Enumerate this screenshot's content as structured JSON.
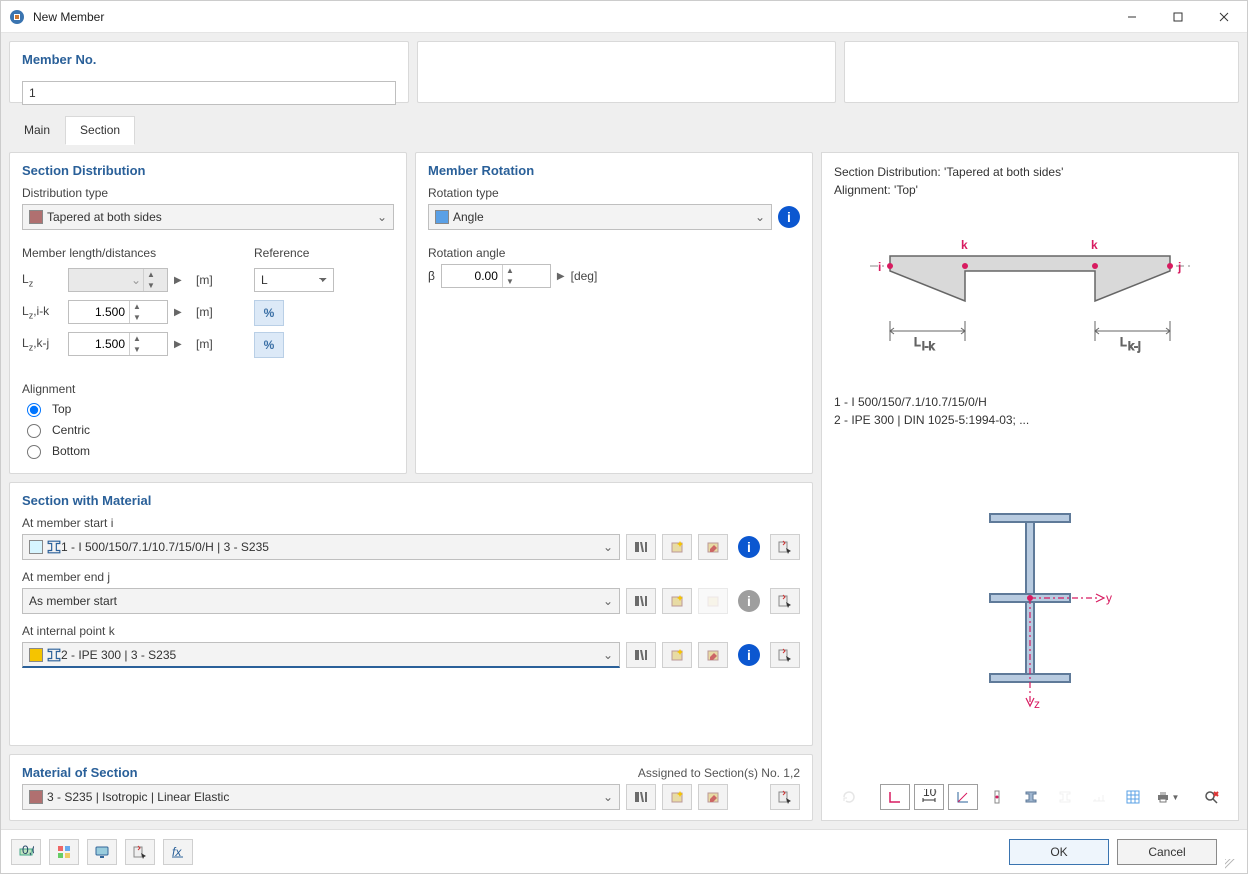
{
  "window": {
    "title": "New Member"
  },
  "header": {
    "member_no_label": "Member No.",
    "member_no_value": "1"
  },
  "tabs": {
    "main": "Main",
    "section": "Section",
    "active": "section"
  },
  "distribution": {
    "panel_title": "Section Distribution",
    "type_label": "Distribution type",
    "type_value": "Tapered at both sides",
    "color": "#b07070",
    "length_label": "Member length/distances",
    "reference_label": "Reference",
    "reference_value": "L",
    "rows": {
      "lz": {
        "label_html": "L<sub>z</sub>",
        "value": "",
        "unit": "[m]",
        "disabled": true
      },
      "lzik": {
        "label_html": "L<sub>z</sub>,i-k",
        "value": "1.500",
        "unit": "[m]",
        "disabled": false
      },
      "lzkj": {
        "label_html": "L<sub>z</sub>,k-j",
        "value": "1.500",
        "unit": "[m]",
        "disabled": false
      }
    },
    "alignment_label": "Alignment",
    "alignment_options": {
      "top": "Top",
      "centric": "Centric",
      "bottom": "Bottom"
    },
    "alignment_selected": "top"
  },
  "rotation": {
    "panel_title": "Member Rotation",
    "type_label": "Rotation type",
    "type_value": "Angle",
    "type_color": "#5aa0e6",
    "angle_label": "Rotation angle",
    "angle_symbol": "β",
    "angle_value": "0.00",
    "angle_unit": "[deg]"
  },
  "swm": {
    "panel_title": "Section with Material",
    "start": {
      "label": "At member start i",
      "value": "1 - I 500/150/7.1/10.7/15/0/H | 3 - S235",
      "color": "#d6f5ff"
    },
    "end": {
      "label": "At member end j",
      "value": "As member start"
    },
    "internal": {
      "label": "At internal point k",
      "value": "2 - IPE 300 | 3 - S235",
      "color": "#f5c400",
      "highlight": true
    }
  },
  "material": {
    "panel_title": "Material of Section",
    "assigned_label": "Assigned to Section(s) No. 1,2",
    "value": "3 - S235 | Isotropic | Linear Elastic",
    "color": "#b07070"
  },
  "preview": {
    "dist_text": "Section Distribution: 'Tapered at both sides'",
    "align_text": "Alignment: 'Top'",
    "sections_text1": "1 - I 500/150/7.1/10.7/15/0/H",
    "sections_text2": "2 - IPE 300 | DIN 1025-5:1994-03; ...",
    "labels": {
      "i": "i",
      "j": "j",
      "k": "k",
      "lik": "Li-k",
      "lkj": "Lk-j",
      "y": "y",
      "z": "z"
    }
  },
  "footer": {
    "ok": "OK",
    "cancel": "Cancel"
  },
  "icons": {
    "library": "library-icon",
    "new": "new-icon",
    "edit": "edit-icon",
    "info": "info-icon",
    "pick": "pick-icon"
  }
}
